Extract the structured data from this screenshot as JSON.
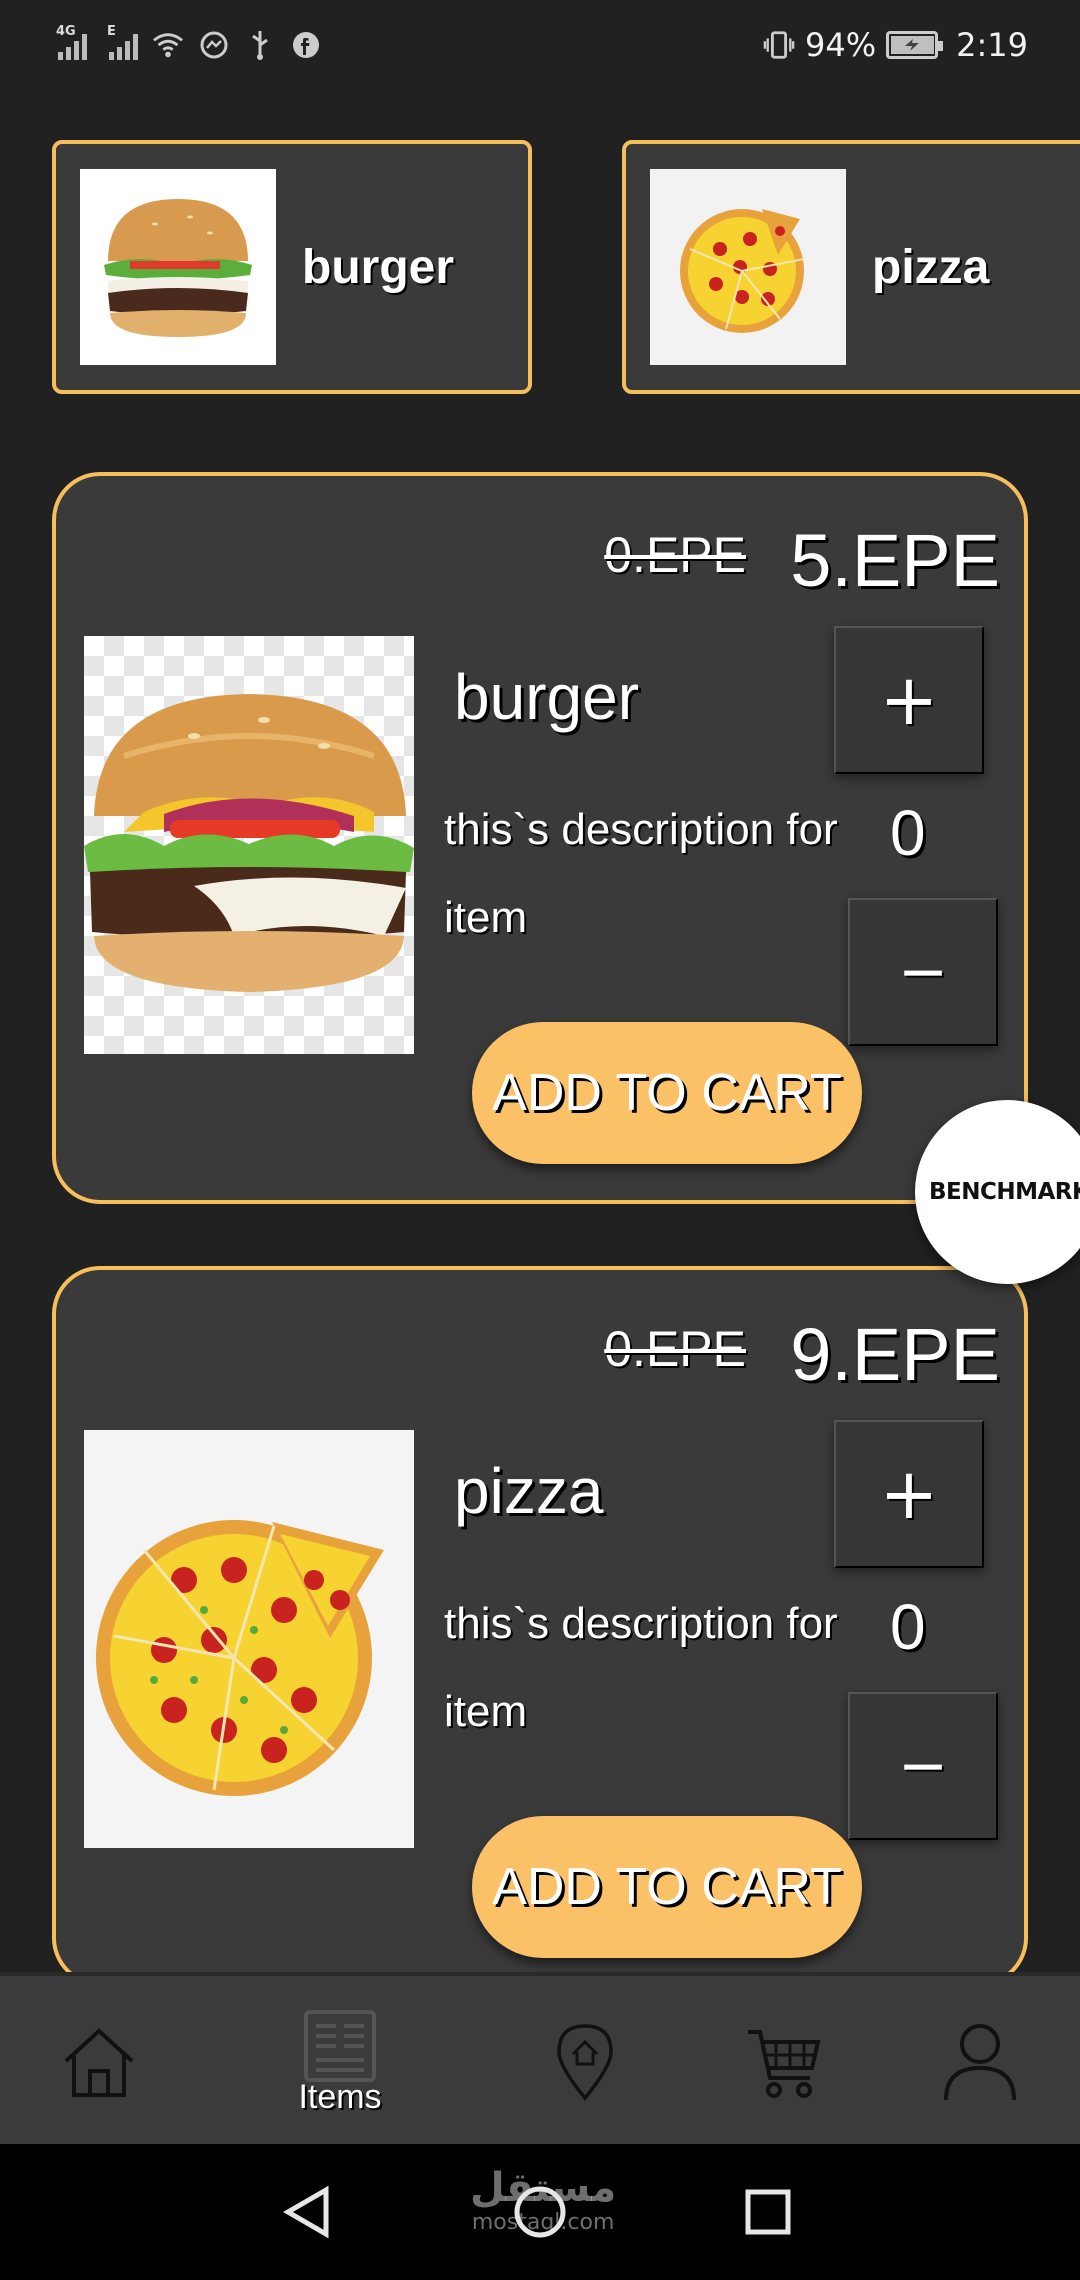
{
  "status_bar": {
    "network_1": "4G",
    "network_2": "E",
    "battery_percent": "94%",
    "time": "2:19",
    "icons": [
      "signal-icon",
      "signal-icon",
      "wifi-icon",
      "messenger-icon",
      "usb-icon",
      "facebook-icon",
      "vibrate-icon",
      "battery-icon"
    ]
  },
  "categories": [
    {
      "label": "burger",
      "image": "burger-image"
    },
    {
      "label": "pizza",
      "image": "pizza-image"
    }
  ],
  "items": [
    {
      "old_price": "0.EPE",
      "new_price": "5.EPE",
      "name": "burger",
      "description": "this`s description for item",
      "quantity": "0",
      "plus_label": "+",
      "minus_label": "−",
      "add_label": "ADD TO CART",
      "image": "burger-image"
    },
    {
      "old_price": "0.EPE",
      "new_price": "9.EPE",
      "name": "pizza",
      "description": "this`s description for item",
      "quantity": "0",
      "plus_label": "+",
      "minus_label": "−",
      "add_label": "ADD TO CART",
      "image": "pizza-image"
    }
  ],
  "fab": {
    "label": "BENCHMARK"
  },
  "bottom_nav": {
    "items": [
      {
        "icon": "home-icon",
        "label": ""
      },
      {
        "icon": "items-icon",
        "label": "Items"
      },
      {
        "icon": "location-icon",
        "label": ""
      },
      {
        "icon": "cart-icon",
        "label": ""
      },
      {
        "icon": "profile-icon",
        "label": ""
      }
    ],
    "active_index": 1
  },
  "system_nav": {
    "buttons": [
      "back-icon",
      "home-circle-icon",
      "recents-icon"
    ],
    "watermark_ar": "مستقل",
    "watermark_en": "mostaql.com"
  },
  "colors": {
    "background": "#212121",
    "card": "#3a3a3a",
    "accent": "#f6bf5c",
    "button": "#fbc166"
  }
}
